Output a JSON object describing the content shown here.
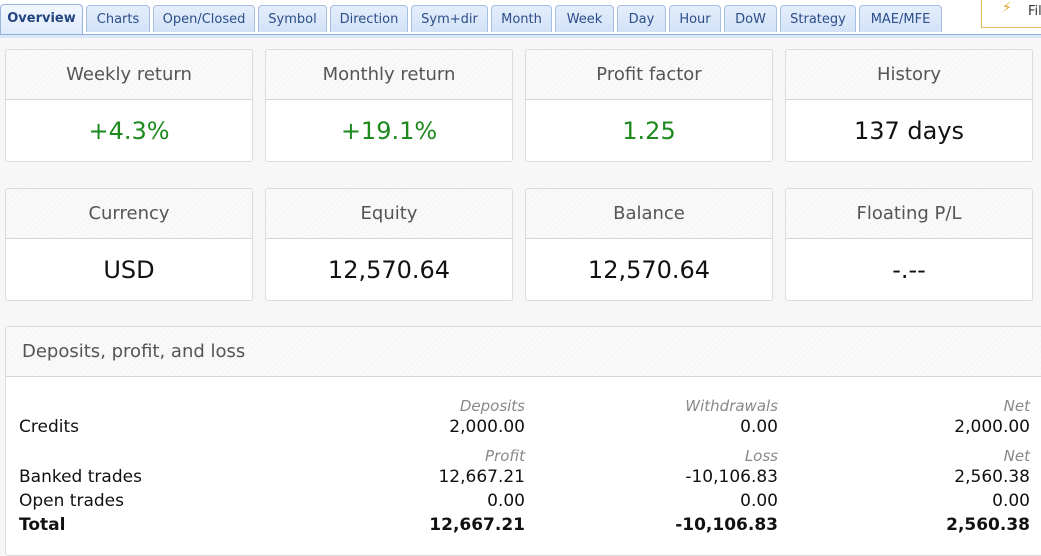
{
  "tabs": [
    {
      "label": "Overview",
      "active": true
    },
    {
      "label": "Charts"
    },
    {
      "label": "Open/Closed"
    },
    {
      "label": "Symbol"
    },
    {
      "label": "Direction"
    },
    {
      "label": "Sym+dir"
    },
    {
      "label": "Month"
    },
    {
      "label": "Week"
    },
    {
      "label": "Day"
    },
    {
      "label": "Hour"
    },
    {
      "label": "DoW"
    },
    {
      "label": "Strategy"
    },
    {
      "label": "MAE/MFE"
    }
  ],
  "filter_button": {
    "icon": "lightning-filter-icon",
    "label": "Fil"
  },
  "cards": [
    {
      "title": "Weekly return",
      "value": "+4.3%",
      "positive": true
    },
    {
      "title": "Monthly return",
      "value": "+19.1%",
      "positive": true
    },
    {
      "title": "Profit factor",
      "value": "1.25",
      "positive": true
    },
    {
      "title": "History",
      "value": "137 days"
    },
    {
      "title": "Currency",
      "value": "USD"
    },
    {
      "title": "Equity",
      "value": "12,570.64"
    },
    {
      "title": "Balance",
      "value": "12,570.64"
    },
    {
      "title": "Floating P/L",
      "value": "-.--"
    }
  ],
  "colors": {
    "positive": "#1d8a1d",
    "tab_text": "#2c4e8a",
    "tab_border": "#a6bfe3"
  },
  "dpl": {
    "title": "Deposits, profit, and loss",
    "credits_headers": [
      "Deposits",
      "Withdrawals",
      "Net"
    ],
    "credits": {
      "label": "Credits",
      "values": [
        "2,000.00",
        "0.00",
        "2,000.00"
      ]
    },
    "trades_headers": [
      "Profit",
      "Loss",
      "Net"
    ],
    "rows": [
      {
        "label": "Banked trades",
        "values": [
          "12,667.21",
          "-10,106.83",
          "2,560.38"
        ]
      },
      {
        "label": "Open trades",
        "values": [
          "0.00",
          "0.00",
          "0.00"
        ]
      },
      {
        "label": "Total",
        "values": [
          "12,667.21",
          "-10,106.83",
          "2,560.38"
        ]
      }
    ]
  }
}
